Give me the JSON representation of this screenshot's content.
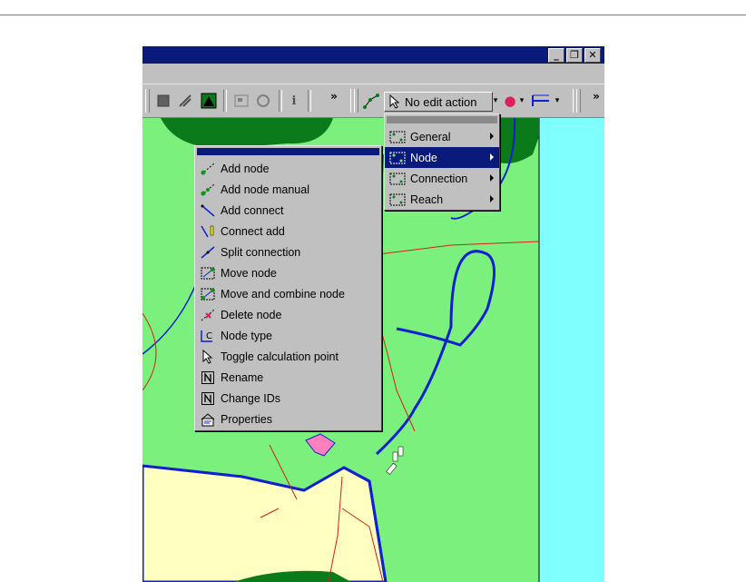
{
  "window": {
    "buttons": [
      {
        "name": "minimize-button",
        "glyph": "_"
      },
      {
        "name": "restore-button",
        "glyph": "❐"
      },
      {
        "name": "close-button",
        "glyph": "✕"
      }
    ]
  },
  "toolbar": {
    "overflow_glyph": "»",
    "info_glyph": "i",
    "edit_action_label": "No edit action",
    "dropdown_glyph": "▾",
    "record_glyph": "●",
    "record_color": "#e0205a"
  },
  "submenu": {
    "items": [
      {
        "label": "General",
        "selected": false
      },
      {
        "label": "Node",
        "selected": true
      },
      {
        "label": "Connection",
        "selected": false
      },
      {
        "label": "Reach",
        "selected": false
      }
    ]
  },
  "node_menu": {
    "items": [
      {
        "label": "Add node",
        "icon": "add-node-icon"
      },
      {
        "label": "Add node manual",
        "icon": "add-node-manual-icon"
      },
      {
        "label": "Add connect",
        "icon": "add-connect-icon"
      },
      {
        "label": "Connect add",
        "icon": "connect-add-icon"
      },
      {
        "label": "Split connection",
        "icon": "split-connection-icon"
      },
      {
        "label": "Move node",
        "icon": "move-node-icon"
      },
      {
        "label": "Move and combine node",
        "icon": "move-combine-node-icon"
      },
      {
        "label": "Delete node",
        "icon": "delete-node-icon"
      },
      {
        "label": "Node type",
        "icon": "node-type-icon"
      },
      {
        "label": "Toggle calculation point",
        "icon": "pointer-icon"
      },
      {
        "label": "Rename",
        "icon": "rename-icon"
      },
      {
        "label": "Change IDs",
        "icon": "change-ids-icon"
      },
      {
        "label": "Properties",
        "icon": "properties-icon"
      }
    ]
  },
  "colors": {
    "titlebar": "#0a1a7a",
    "land": "#7cf07c",
    "water": "#80ffff",
    "urban": "#ffffbf",
    "forest": "#0a7a1a",
    "river": "#1020d0",
    "road": "#d02020"
  }
}
